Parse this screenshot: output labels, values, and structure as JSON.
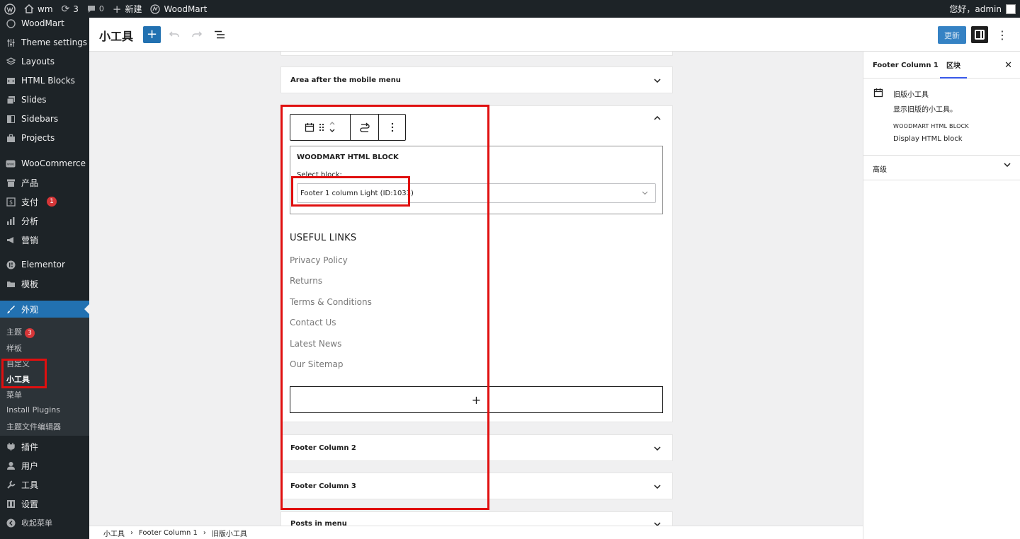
{
  "admin_bar": {
    "site_name": "wm",
    "updates_count": "3",
    "comments_count": "0",
    "new_label": "新建",
    "theme_label": "WoodMart",
    "greeting": "您好，admin"
  },
  "sidebar": {
    "items": [
      {
        "label": "WoodMart",
        "icon": "woodmart-icon"
      },
      {
        "label": "Theme settings",
        "icon": "sliders-icon"
      },
      {
        "label": "Layouts",
        "icon": "layers-icon"
      },
      {
        "label": "HTML Blocks",
        "icon": "html-icon"
      },
      {
        "label": "Slides",
        "icon": "images-icon"
      },
      {
        "label": "Sidebars",
        "icon": "sidebar-icon"
      },
      {
        "label": "Projects",
        "icon": "briefcase-icon"
      },
      {
        "label": "WooCommerce",
        "icon": "woo-icon"
      },
      {
        "label": "产品",
        "icon": "archive-icon"
      },
      {
        "label": "支付",
        "icon": "dollar-icon",
        "badge": "1"
      },
      {
        "label": "分析",
        "icon": "chart-icon"
      },
      {
        "label": "营销",
        "icon": "megaphone-icon"
      },
      {
        "label": "Elementor",
        "icon": "elementor-icon"
      },
      {
        "label": "模板",
        "icon": "folder-icon"
      },
      {
        "label": "外观",
        "icon": "brush-icon"
      },
      {
        "label": "插件",
        "icon": "plugin-icon"
      },
      {
        "label": "用户",
        "icon": "user-icon"
      },
      {
        "label": "工具",
        "icon": "wrench-icon"
      },
      {
        "label": "设置",
        "icon": "settings-icon"
      },
      {
        "label": "收起菜单",
        "icon": "collapse-icon"
      }
    ],
    "submenu": [
      {
        "label": "主题",
        "badge": "3"
      },
      {
        "label": "样板"
      },
      {
        "label": "自定义"
      },
      {
        "label": "小工具"
      },
      {
        "label": "菜单"
      },
      {
        "label": "Install Plugins"
      },
      {
        "label": "主题文件编辑器"
      }
    ]
  },
  "header": {
    "title": "小工具",
    "update_button": "更新"
  },
  "canvas": {
    "area_mobile": "Area after the mobile menu",
    "widget_title": "WOODMART HTML BLOCK",
    "select_label": "Select block:",
    "select_value": "Footer 1 column Light (ID:1033)",
    "links_title": "USEFUL LINKS",
    "links": [
      "Privacy Policy",
      "Returns",
      "Terms & Conditions",
      "Contact Us",
      "Latest News",
      "Our Sitemap"
    ],
    "appender_symbol": "+",
    "footer_col2": "Footer Column 2",
    "footer_col3": "Footer Column 3",
    "posts_in_menu": "Posts in menu"
  },
  "inspector": {
    "tab_area": "Footer Column 1",
    "tab_block": "区块",
    "block_title": "旧版小工具",
    "block_desc": "显示旧版的小工具。",
    "widget_tag": "WOODMART HTML BLOCK",
    "widget_sub": "Display HTML block",
    "advanced": "高级"
  },
  "breadcrumb": [
    "小工具",
    "Footer Column 1",
    "旧版小工具"
  ],
  "colors": {
    "admin_dark": "#1d2327",
    "accent": "#2271b1",
    "highlight": "#e00f0f"
  }
}
